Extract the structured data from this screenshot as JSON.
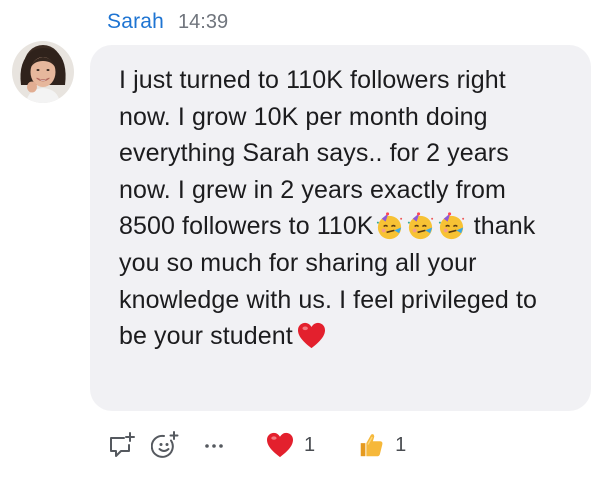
{
  "message": {
    "sender": "Sarah",
    "time": "14:39",
    "avatar_icon": "user-avatar-photo",
    "text_parts": {
      "p1": "I just turned to 110K followers right now. I grow 10K per month doing everything Sarah says.. for 2 years now. I grew in 2 years exactly from 8500 followers to 110K",
      "p2": "thank you so much for sharing all your knowledge with us. I feel privileged to be your student"
    },
    "inline_emojis": [
      "partying-face-emoji",
      "partying-face-emoji",
      "partying-face-emoji",
      "red-heart-emoji"
    ]
  },
  "actions": {
    "reply_icon": "reply-icon",
    "add_reaction_icon": "add-reaction-icon",
    "more_icon": "more-icon",
    "reactions": [
      {
        "icon": "red-heart-icon",
        "count": "1"
      },
      {
        "icon": "thumbs-up-icon",
        "count": "1"
      }
    ]
  },
  "colors": {
    "sender": "#1e74d2",
    "timestamp": "#70757d",
    "bubble_background": "#f1f1f4",
    "text": "#1c1c1e",
    "icon": "#55595f",
    "heart": "#e0202e",
    "thumb": "#f6b83a"
  }
}
